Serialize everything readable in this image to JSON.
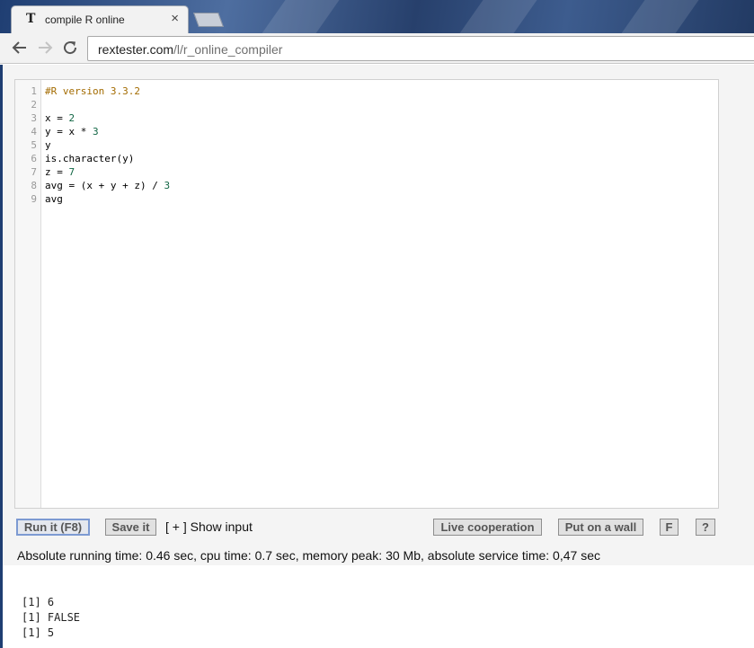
{
  "browser": {
    "tab_title": "compile R online",
    "tab_favicon": "T",
    "tab_close": "×",
    "url_domain": "rextester.com",
    "url_path": "/l/r_online_compiler",
    "icons": [
      "back-arrow-icon",
      "forward-arrow-icon",
      "reload-icon",
      "close-icon"
    ]
  },
  "editor": {
    "line_numbers": [
      "1",
      "2",
      "3",
      "4",
      "5",
      "6",
      "7",
      "8",
      "9"
    ],
    "lines": [
      "#R version 3.3.2",
      "",
      "x = 2",
      "y = x * 3",
      "y",
      "is.character(y)",
      "z = 7",
      "avg = (x + y + z) / 3",
      "avg"
    ]
  },
  "controls": {
    "run_label": "Run it (F8)",
    "save_label": "Save it",
    "show_input_label": "[ + ] Show input",
    "live_coop_label": "Live cooperation",
    "wall_label": "Put on a wall",
    "f_label": "F",
    "help_label": "?"
  },
  "stats": "Absolute running time: 0.46 sec, cpu time: 0.7 sec, memory peak: 30 Mb, absolute service time: 0,47 sec",
  "output": [
    "[1] 6",
    "[1] FALSE",
    "[1] 5"
  ],
  "colors": {
    "comment": "#a36b00",
    "number": "#116644",
    "primary_button_border": "#7d9ad2"
  }
}
